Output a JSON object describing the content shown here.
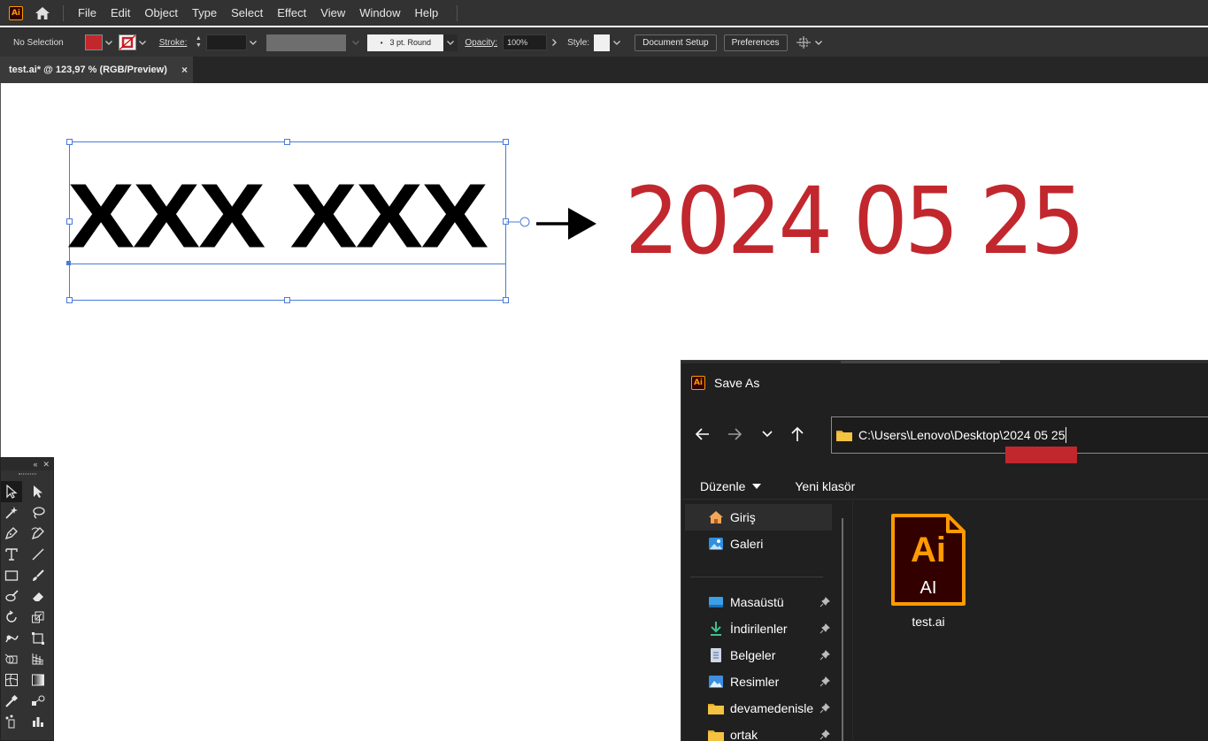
{
  "app": {
    "logo_text": "Ai",
    "brand_color": "#ff9a00"
  },
  "menu": {
    "items": [
      "File",
      "Edit",
      "Object",
      "Type",
      "Select",
      "Effect",
      "View",
      "Window",
      "Help"
    ]
  },
  "control_bar": {
    "selection_label": "No Selection",
    "fill_color": "#c1272d",
    "stroke_label": "Stroke:",
    "brush_value": "3 pt. Round",
    "opacity_label": "Opacity:",
    "opacity_value": "100%",
    "style_label": "Style:",
    "document_setup_label": "Document Setup",
    "preferences_label": "Preferences"
  },
  "document_tab": {
    "title": "test.ai* @ 123,97 % (RGB/Preview)",
    "close_glyph": "×"
  },
  "artboard": {
    "placeholder_text": "XXX XXX",
    "date_text": "2024 05 25",
    "date_color": "#c1272d"
  },
  "tools_panel": {
    "tools": [
      "selection-tool",
      "direct-selection-tool",
      "magic-wand-tool",
      "lasso-tool",
      "pen-tool",
      "curvature-tool",
      "type-tool",
      "line-segment-tool",
      "rectangle-tool",
      "paintbrush-tool",
      "shaper-tool",
      "eraser-tool",
      "rotate-tool",
      "scale-tool",
      "warp-tool",
      "free-transform-tool",
      "shape-builder-tool",
      "perspective-grid-tool",
      "mesh-tool",
      "gradient-tool",
      "eyedropper-tool",
      "blend-tool",
      "symbol-sprayer-tool",
      "column-graph-tool"
    ]
  },
  "save_dialog": {
    "title": "Save As",
    "path": "C:\\Users\\Lenovo\\Desktop\\2024 05 25",
    "commands": {
      "organize": "Düzenle",
      "new_folder": "Yeni klasör"
    },
    "nav_items": [
      {
        "label": "Giriş",
        "icon": "home-icon"
      },
      {
        "label": "Galeri",
        "icon": "gallery-icon"
      },
      {
        "label": "Masaüstü",
        "icon": "desktop-icon"
      },
      {
        "label": "İndirilenler",
        "icon": "downloads-icon"
      },
      {
        "label": "Belgeler",
        "icon": "documents-icon"
      },
      {
        "label": "Resimler",
        "icon": "pictures-icon"
      },
      {
        "label": "devamedenisle",
        "icon": "folder-icon"
      },
      {
        "label": "ortak",
        "icon": "folder-icon"
      }
    ],
    "file": {
      "name": "test.ai",
      "icon_big": "Ai",
      "icon_small": "AI"
    }
  }
}
